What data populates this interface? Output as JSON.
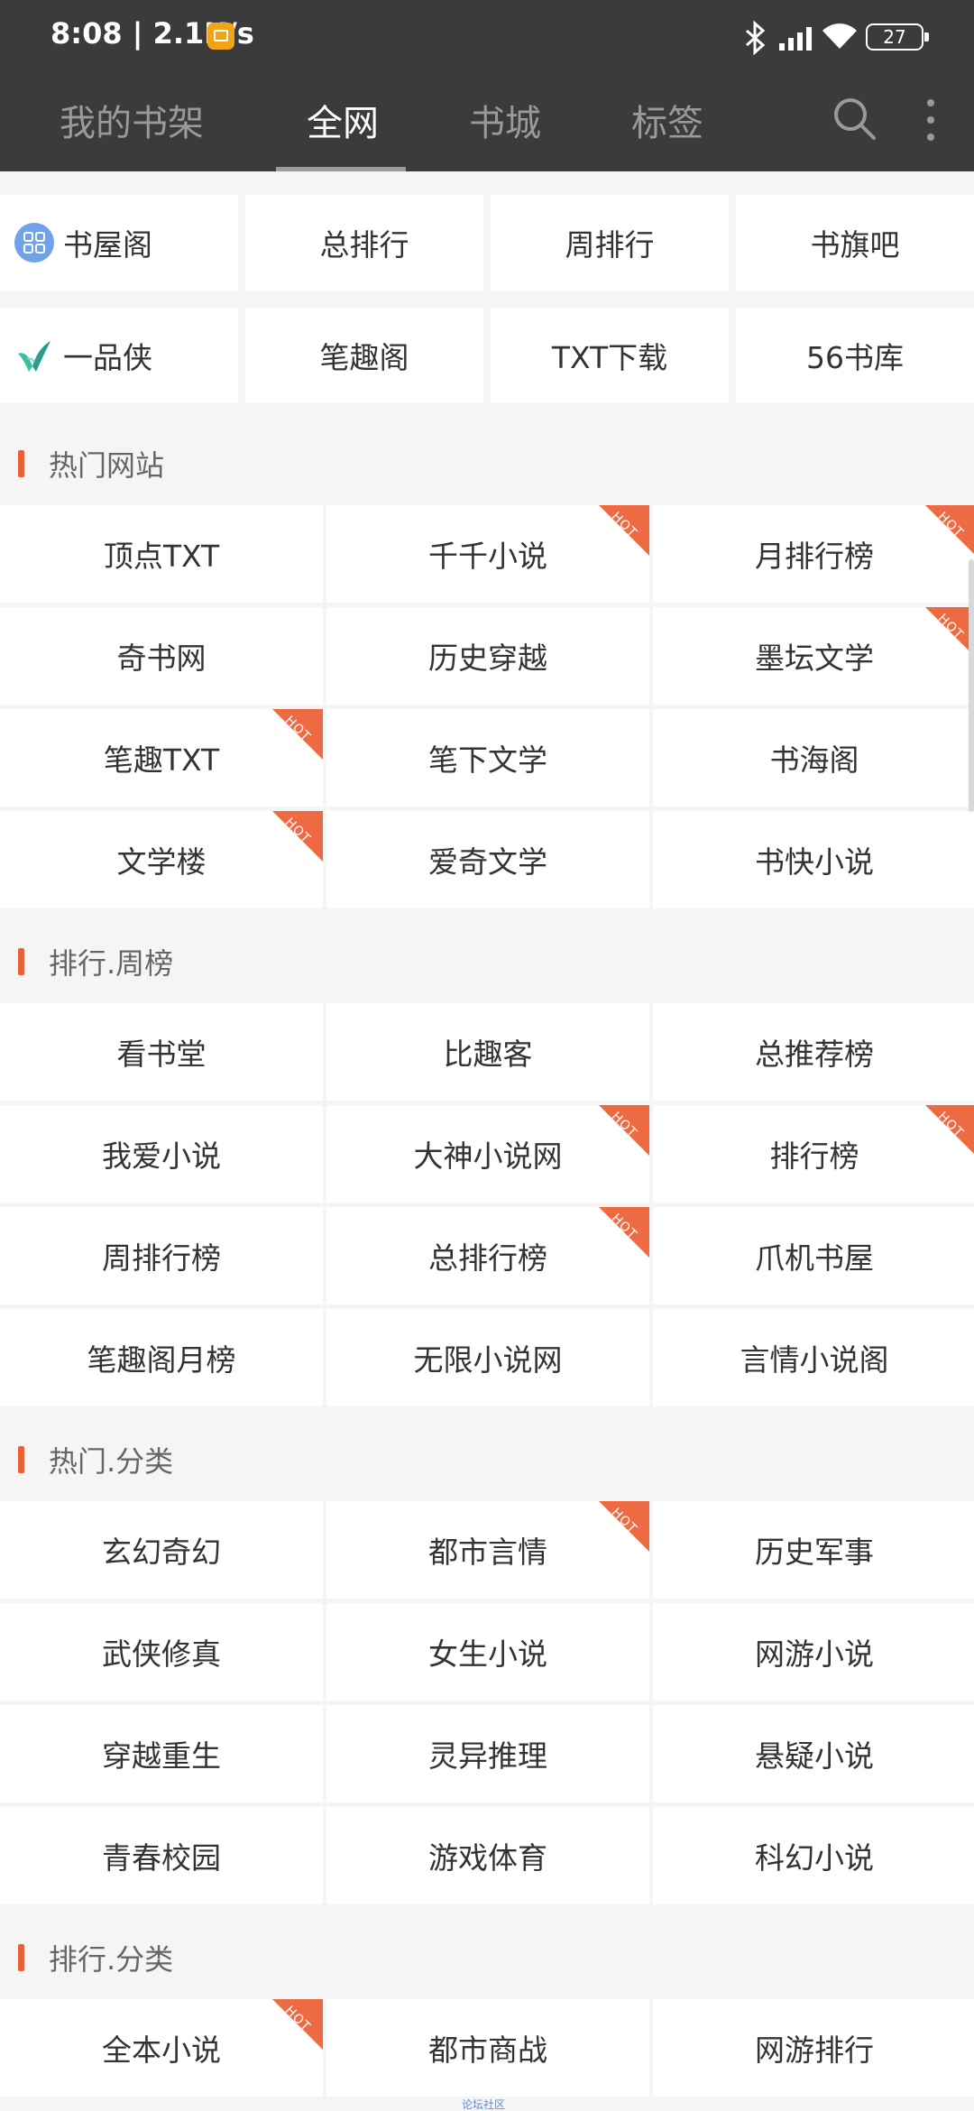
{
  "status": {
    "time": "8:08 | 2.1K/s",
    "battery": "27"
  },
  "tabs": [
    "我的书架",
    "全网",
    "书城",
    "标签"
  ],
  "quick": [
    "书屋阁",
    "总排行",
    "周排行",
    "书旗吧",
    "一品侠",
    "笔趣阁",
    "TXT下载",
    "56书库"
  ],
  "sections": [
    {
      "title": "热门网站",
      "items": [
        {
          "label": "顶点TXT",
          "hot": false
        },
        {
          "label": "千千小说",
          "hot": true
        },
        {
          "label": "月排行榜",
          "hot": true
        },
        {
          "label": "奇书网",
          "hot": false
        },
        {
          "label": "历史穿越",
          "hot": false
        },
        {
          "label": "墨坛文学",
          "hot": true
        },
        {
          "label": "笔趣TXT",
          "hot": true
        },
        {
          "label": "笔下文学",
          "hot": false
        },
        {
          "label": "书海阁",
          "hot": false
        },
        {
          "label": "文学楼",
          "hot": true
        },
        {
          "label": "爱奇文学",
          "hot": false
        },
        {
          "label": "书快小说",
          "hot": false
        }
      ]
    },
    {
      "title": "排行.周榜",
      "items": [
        {
          "label": "看书堂",
          "hot": false
        },
        {
          "label": "比趣客",
          "hot": false
        },
        {
          "label": "总推荐榜",
          "hot": false
        },
        {
          "label": "我爱小说",
          "hot": false
        },
        {
          "label": "大神小说网",
          "hot": true
        },
        {
          "label": "排行榜",
          "hot": true
        },
        {
          "label": "周排行榜",
          "hot": false
        },
        {
          "label": "总排行榜",
          "hot": true
        },
        {
          "label": "爪机书屋",
          "hot": false
        },
        {
          "label": "笔趣阁月榜",
          "hot": false
        },
        {
          "label": "无限小说网",
          "hot": false
        },
        {
          "label": "言情小说阁",
          "hot": false
        }
      ]
    },
    {
      "title": "热门.分类",
      "items": [
        {
          "label": "玄幻奇幻",
          "hot": false
        },
        {
          "label": "都市言情",
          "hot": true
        },
        {
          "label": "历史军事",
          "hot": false
        },
        {
          "label": "武侠修真",
          "hot": false
        },
        {
          "label": "女生小说",
          "hot": false
        },
        {
          "label": "网游小说",
          "hot": false
        },
        {
          "label": "穿越重生",
          "hot": false
        },
        {
          "label": "灵异推理",
          "hot": false
        },
        {
          "label": "悬疑小说",
          "hot": false
        },
        {
          "label": "青春校园",
          "hot": false
        },
        {
          "label": "游戏体育",
          "hot": false
        },
        {
          "label": "科幻小说",
          "hot": false
        }
      ]
    },
    {
      "title": "排行.分类",
      "items": [
        {
          "label": "全本小说",
          "hot": true
        },
        {
          "label": "都市商战",
          "hot": false
        },
        {
          "label": "网游排行",
          "hot": false
        }
      ]
    }
  ],
  "hot_badge": "HOT",
  "footer_tag": "论坛社区",
  "colors": {
    "accent": "#e8613b",
    "topbar": "#3b3b3b"
  }
}
